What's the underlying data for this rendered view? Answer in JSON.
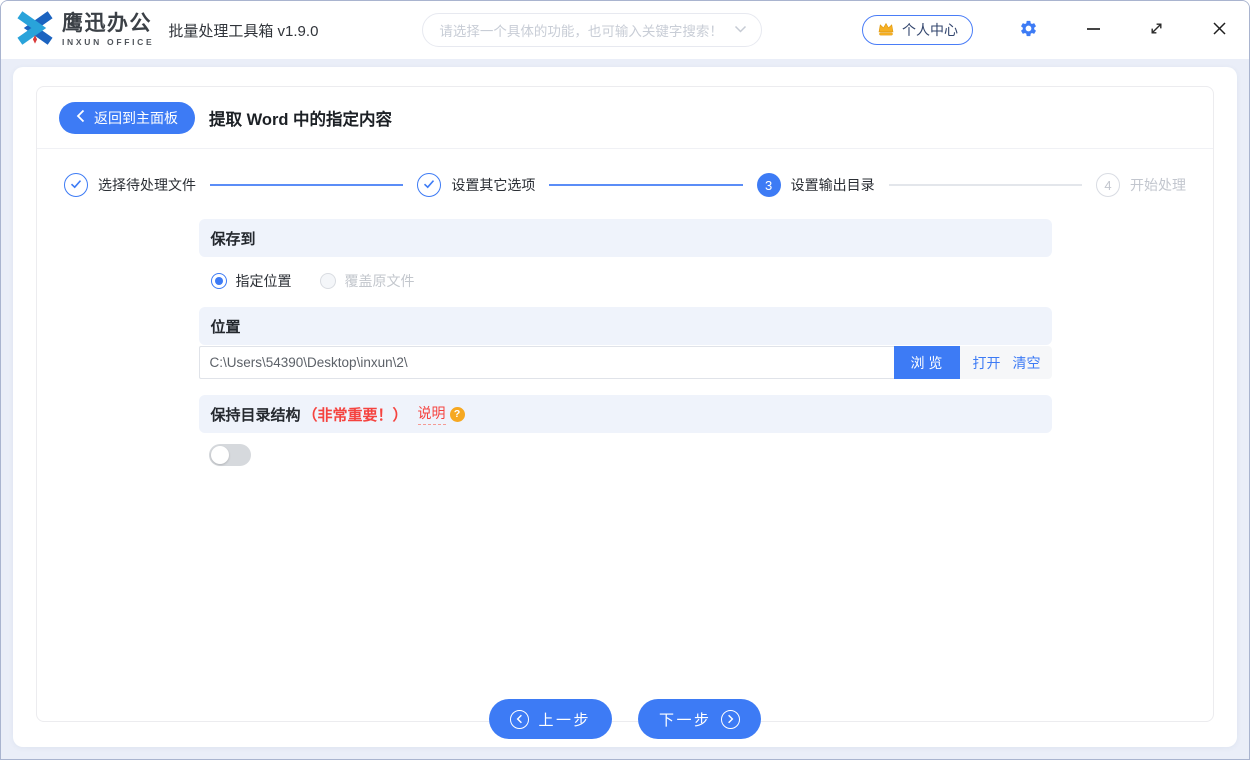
{
  "topbar": {
    "logo_title": "鹰迅办公",
    "logo_subtitle": "INXUN OFFICE",
    "app_title": "批量处理工具箱 v1.9.0",
    "search_placeholder": "请选择一个具体的功能，也可输入关键字搜索！",
    "user_center_label": "个人中心"
  },
  "page": {
    "back_label": "返回到主面板",
    "title": "提取 Word 中的指定内容"
  },
  "steps": [
    {
      "label": "选择待处理文件",
      "state": "done"
    },
    {
      "label": "设置其它选项",
      "state": "done"
    },
    {
      "label": "设置输出目录",
      "state": "active",
      "number": "3"
    },
    {
      "label": "开始处理",
      "state": "pending",
      "number": "4"
    }
  ],
  "save_to": {
    "header": "保存到",
    "option_specified": "指定位置",
    "option_overwrite": "覆盖原文件"
  },
  "location": {
    "header": "位置",
    "path": "C:\\Users\\54390\\Desktop\\inxun\\2\\",
    "browse_label": "浏 览",
    "open_label": "打开",
    "clear_label": "清空"
  },
  "keep_structure": {
    "header": "保持目录结构",
    "important_note": "（非常重要！）",
    "help_label": "说明",
    "help_badge": "?",
    "toggle_state": "off"
  },
  "footer": {
    "prev_label": "上一步",
    "next_label": "下一步"
  },
  "colors": {
    "primary_blue": "#3d7bf5",
    "band_bg": "#eff3fb",
    "danger_red": "#f5433f",
    "badge_orange": "#f6a821"
  }
}
